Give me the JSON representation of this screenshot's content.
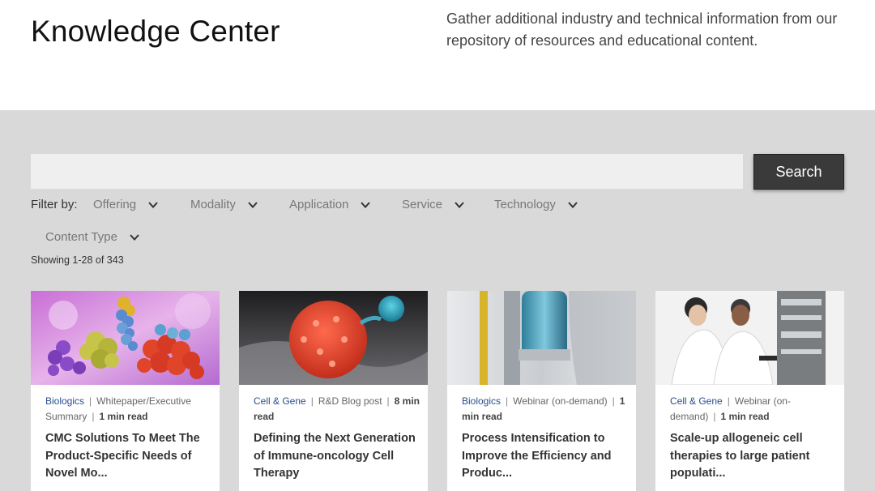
{
  "header": {
    "title": "Knowledge Center",
    "description": "Gather additional industry and technical information from our repository of resources and educational content."
  },
  "search": {
    "placeholder": "",
    "button_label": "Search"
  },
  "filters": {
    "label": "Filter by:",
    "items": [
      "Offering",
      "Modality",
      "Application",
      "Service",
      "Technology",
      "Content Type"
    ]
  },
  "results": {
    "showing": "Showing 1-28 of 343"
  },
  "cards": [
    {
      "category": "Biologics",
      "type": "Whitepaper/Executive Summary",
      "read_time": "1 min read",
      "title": "CMC Solutions To Meet The Product-Specific Needs of Novel Mo..."
    },
    {
      "category": "Cell & Gene",
      "type": "R&D Blog post",
      "read_time": "8 min read",
      "title": "Defining the Next Generation of Immune-oncology Cell Therapy"
    },
    {
      "category": "Biologics",
      "type": "Webinar (on-demand)",
      "read_time": "1 min read",
      "title": "Process Intensification to Improve the Efficiency and Produc..."
    },
    {
      "category": "Cell & Gene",
      "type": "Webinar (on-demand)",
      "read_time": "1 min read",
      "title": "Scale-up allogeneic cell therapies to large patient populati..."
    }
  ],
  "colors": {
    "panel_bg": "#d9d9d9",
    "button_bg": "#3a3a3a",
    "category_link": "#2a4d8f"
  }
}
